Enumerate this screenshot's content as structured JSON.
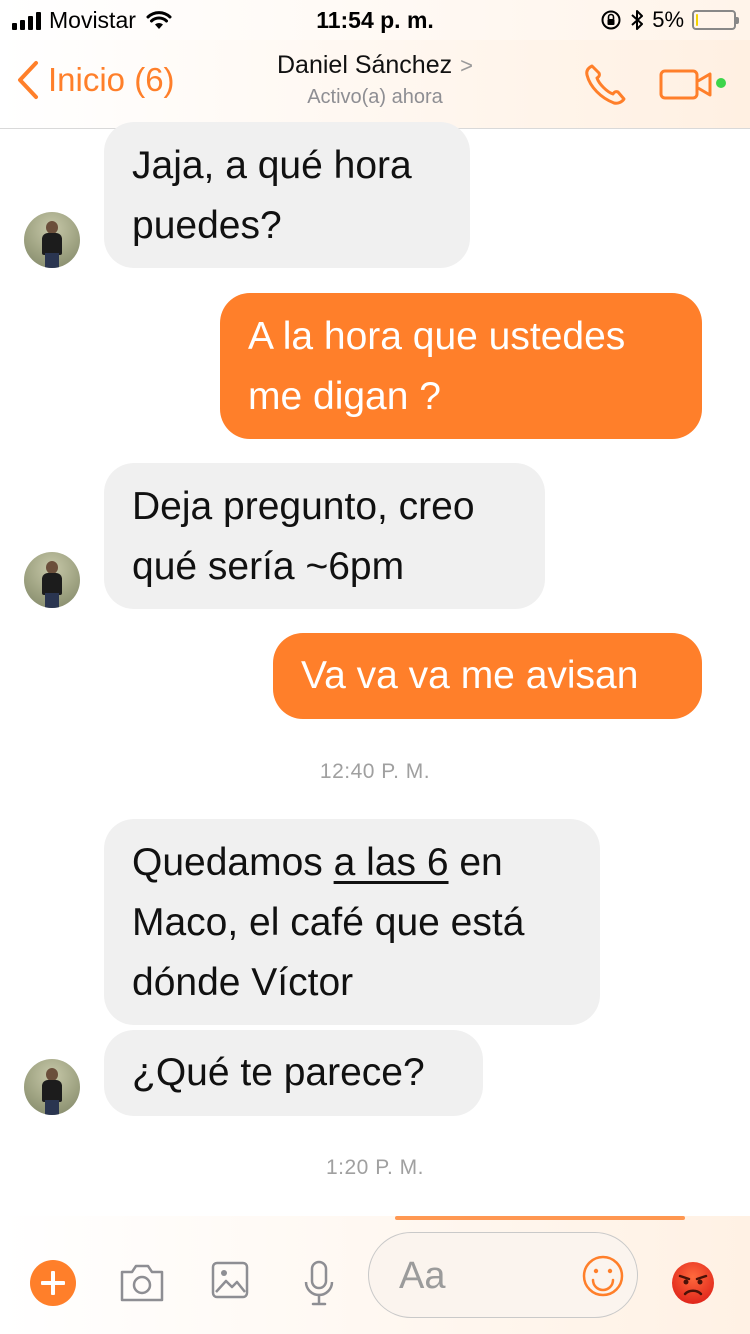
{
  "status_bar": {
    "carrier": "Movistar",
    "time": "11:54 p. m.",
    "battery": "5%",
    "battery_level": 0.05
  },
  "nav": {
    "back_label": "Inicio (6)",
    "contact_name": "Daniel Sánchez",
    "chevron": ">",
    "presence": "Activo(a) ahora",
    "accent": "#ff7f2a",
    "online_color": "#3dd54b"
  },
  "messages": [
    {
      "direction": "in",
      "lines": [
        "Jaja, a qué hora",
        "puedes?"
      ]
    },
    {
      "direction": "out",
      "lines": [
        "A la hora que ustedes",
        "me digan ?"
      ]
    },
    {
      "direction": "in",
      "lines": [
        "Deja pregunto, creo",
        "qué sería ~6pm"
      ]
    },
    {
      "direction": "out",
      "lines": [
        "Va va va me avisan"
      ]
    },
    {
      "timestamp": "12:40 P. M."
    },
    {
      "direction": "in",
      "segments": [
        "Quedamos ",
        "a las 6",
        " en"
      ],
      "lines": [
        "Maco, el café que está",
        "dónde Víctor"
      ]
    },
    {
      "direction": "in",
      "lines": [
        "¿Qué te parece?"
      ]
    },
    {
      "timestamp": "1:20 P. M."
    }
  ],
  "composer": {
    "placeholder": "Aa",
    "icons": [
      "plus-icon",
      "camera-icon",
      "image-icon",
      "microphone-icon",
      "smiley-icon",
      "angry-face-icon"
    ]
  },
  "colors": {
    "outgoing_bubble": "#ff7f2a",
    "incoming_bubble": "#f0f0f0",
    "timestamp_text": "#a0a0a0"
  }
}
